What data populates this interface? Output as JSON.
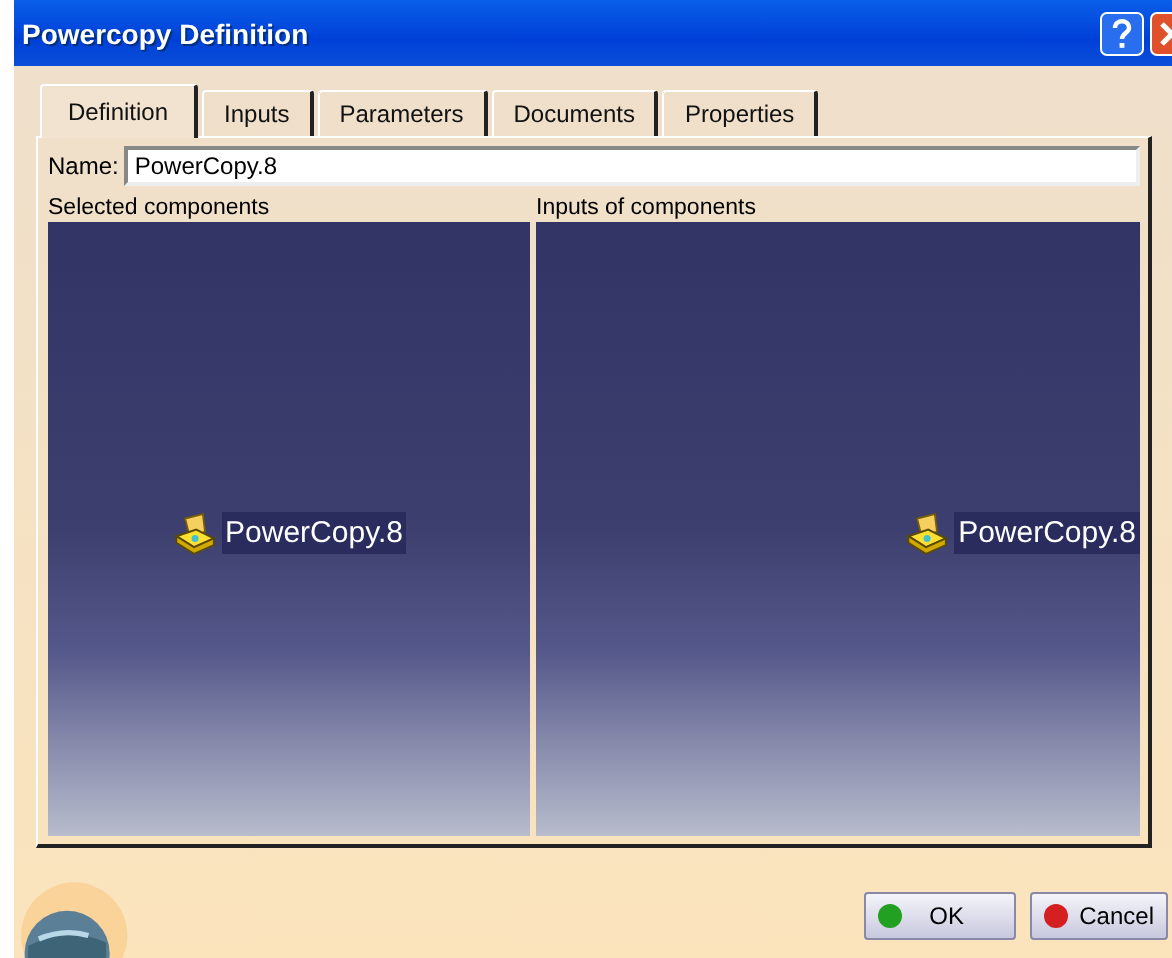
{
  "window": {
    "title": "Powercopy Definition"
  },
  "tabs": [
    {
      "label": "Definition",
      "selected": true
    },
    {
      "label": "Inputs",
      "selected": false
    },
    {
      "label": "Parameters",
      "selected": false
    },
    {
      "label": "Documents",
      "selected": false
    },
    {
      "label": "Properties",
      "selected": false
    }
  ],
  "name_field": {
    "label": "Name:",
    "value": "PowerCopy.8"
  },
  "panels": [
    {
      "heading": "Selected components",
      "item": "PowerCopy.8"
    },
    {
      "heading": "Inputs of components",
      "item": "PowerCopy.8"
    }
  ],
  "buttons": [
    {
      "label": "OK",
      "color": "#22a022"
    },
    {
      "label": "Cancel",
      "color": "#d42020"
    }
  ]
}
